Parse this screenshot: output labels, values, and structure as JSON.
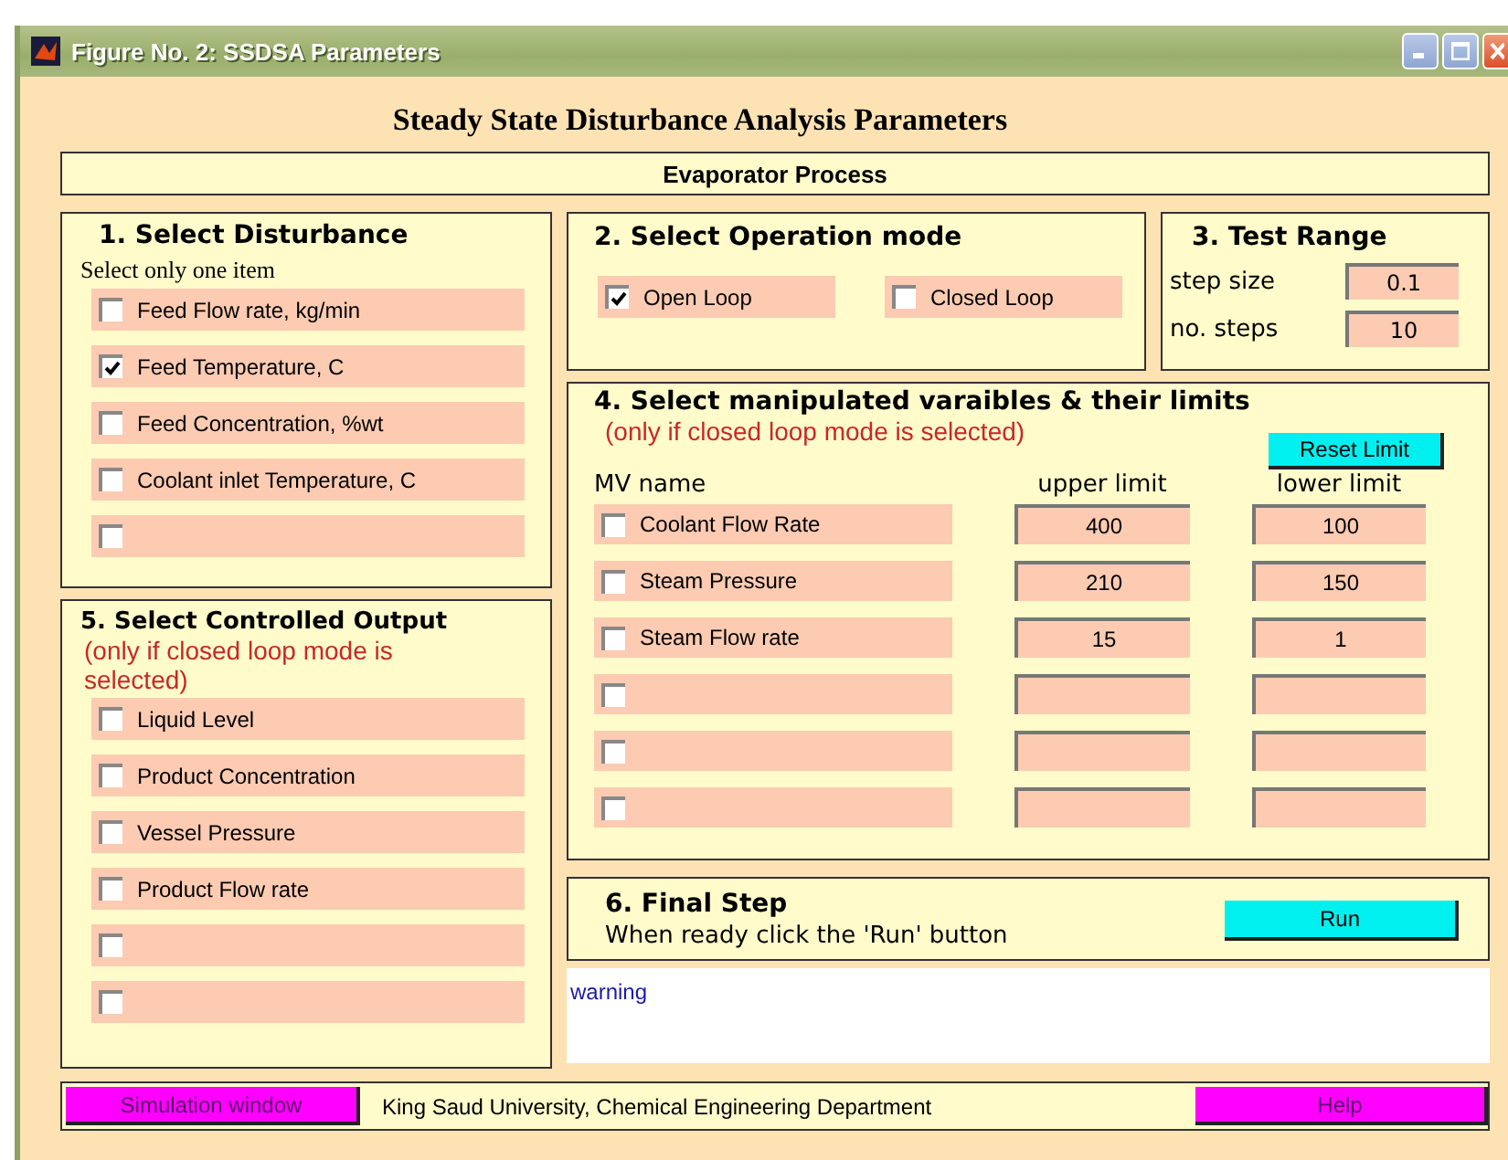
{
  "window": {
    "title": "Figure No. 2: SSDSA Parameters"
  },
  "heading": "Steady State Disturbance Analysis Parameters",
  "process": "Evaporator Process",
  "disturbance": {
    "title": "1. Select Disturbance",
    "hint": "Select only one item",
    "items": [
      {
        "label": "Feed Flow rate, kg/min",
        "checked": false
      },
      {
        "label": "Feed Temperature, C",
        "checked": true
      },
      {
        "label": "Feed Concentration, %wt",
        "checked": false
      },
      {
        "label": "Coolant inlet Temperature, C",
        "checked": false
      },
      {
        "checked": false
      }
    ]
  },
  "operation_mode": {
    "title": "2. Select Operation mode",
    "options": [
      {
        "label": "Open Loop",
        "checked": true
      },
      {
        "label": "Closed Loop",
        "checked": false
      }
    ]
  },
  "test_range": {
    "title": "3. Test Range",
    "fields": [
      {
        "label": "step size",
        "value": "0.1"
      },
      {
        "label": "no. steps",
        "value": "10"
      }
    ]
  },
  "manipulated": {
    "title": "4. Select manipulated varaibles & their limits",
    "note": "(only if closed loop mode is selected)",
    "reset_button": "Reset Limit",
    "columns": [
      "MV name",
      "upper limit",
      "lower limit"
    ],
    "rows": [
      {
        "name": "Coolant Flow Rate",
        "checked": false,
        "upper": "400",
        "lower": "100"
      },
      {
        "name": "Steam Pressure",
        "checked": false,
        "upper": "210",
        "lower": "150"
      },
      {
        "name": "Steam Flow rate",
        "checked": false,
        "upper": "15",
        "lower": "1"
      },
      {
        "checked": false
      },
      {
        "checked": false
      },
      {
        "checked": false
      }
    ]
  },
  "controlled": {
    "title": "5. Select Controlled Output",
    "note": "(only if closed loop mode is selected)",
    "items": [
      {
        "label": "Liquid Level",
        "checked": false
      },
      {
        "label": "Product Concentration",
        "checked": false
      },
      {
        "label": "Vessel Pressure",
        "checked": false
      },
      {
        "label": "Product Flow rate",
        "checked": false
      },
      {
        "checked": false
      },
      {
        "checked": false
      }
    ]
  },
  "final_step": {
    "title": "6. Final Step",
    "instruction": "When ready click the 'Run' button",
    "run_button": "Run"
  },
  "warning": "warning",
  "footer": {
    "left_button": "Simulation window",
    "credit": "King Saud University, Chemical Engineering Department",
    "help_button": "Help"
  }
}
